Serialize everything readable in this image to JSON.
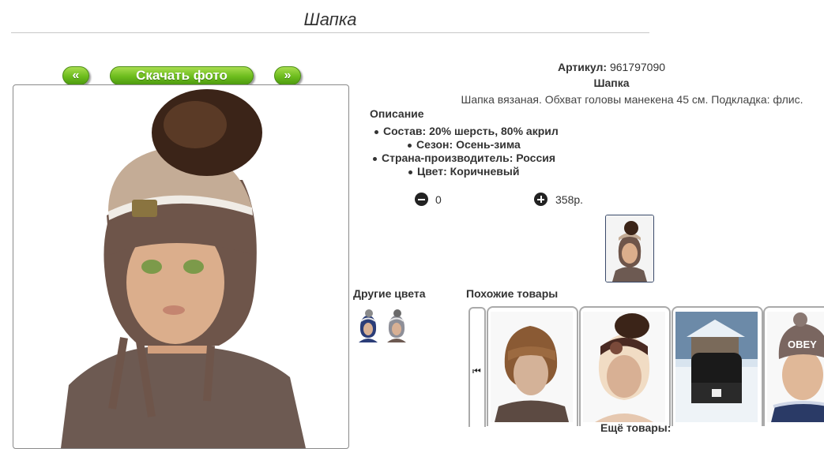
{
  "page": {
    "title": "Шапка"
  },
  "photo_nav": {
    "prev_label": "«",
    "download_label": "Скачать фото",
    "next_label": "»"
  },
  "product": {
    "article_label": "Артикул:",
    "article_value": "961797090",
    "name": "Шапка",
    "description": "Шапка вязаная. Обхват головы манекена 45 см. Подкладка: флис.",
    "description_heading": "Описание",
    "properties": [
      "Состав: 20% шерсть, 80% акрил",
      "Сезон: Осень-зима",
      "Страна-производитель: Россия",
      "Цвет: Коричневый"
    ],
    "quantity": "0",
    "price": "358р."
  },
  "other_colors": {
    "label": "Другие цвета",
    "swatches": [
      "navy-hat-thumb",
      "grey-hat-thumb"
    ]
  },
  "similar": {
    "label": "Похожие товары",
    "items": [
      "brown-knit-hat",
      "brown-pompom-hat",
      "black-beanie-winter",
      "obey-hat-boy"
    ],
    "more_label": "Ещё товары:"
  },
  "colors": {
    "accent_green": "#6cbc1d",
    "hat_brown": "#6e554a",
    "hat_beige": "#c4ac96"
  },
  "icons": [
    "minus-circle-icon",
    "plus-circle-icon",
    "first-page-icon"
  ]
}
